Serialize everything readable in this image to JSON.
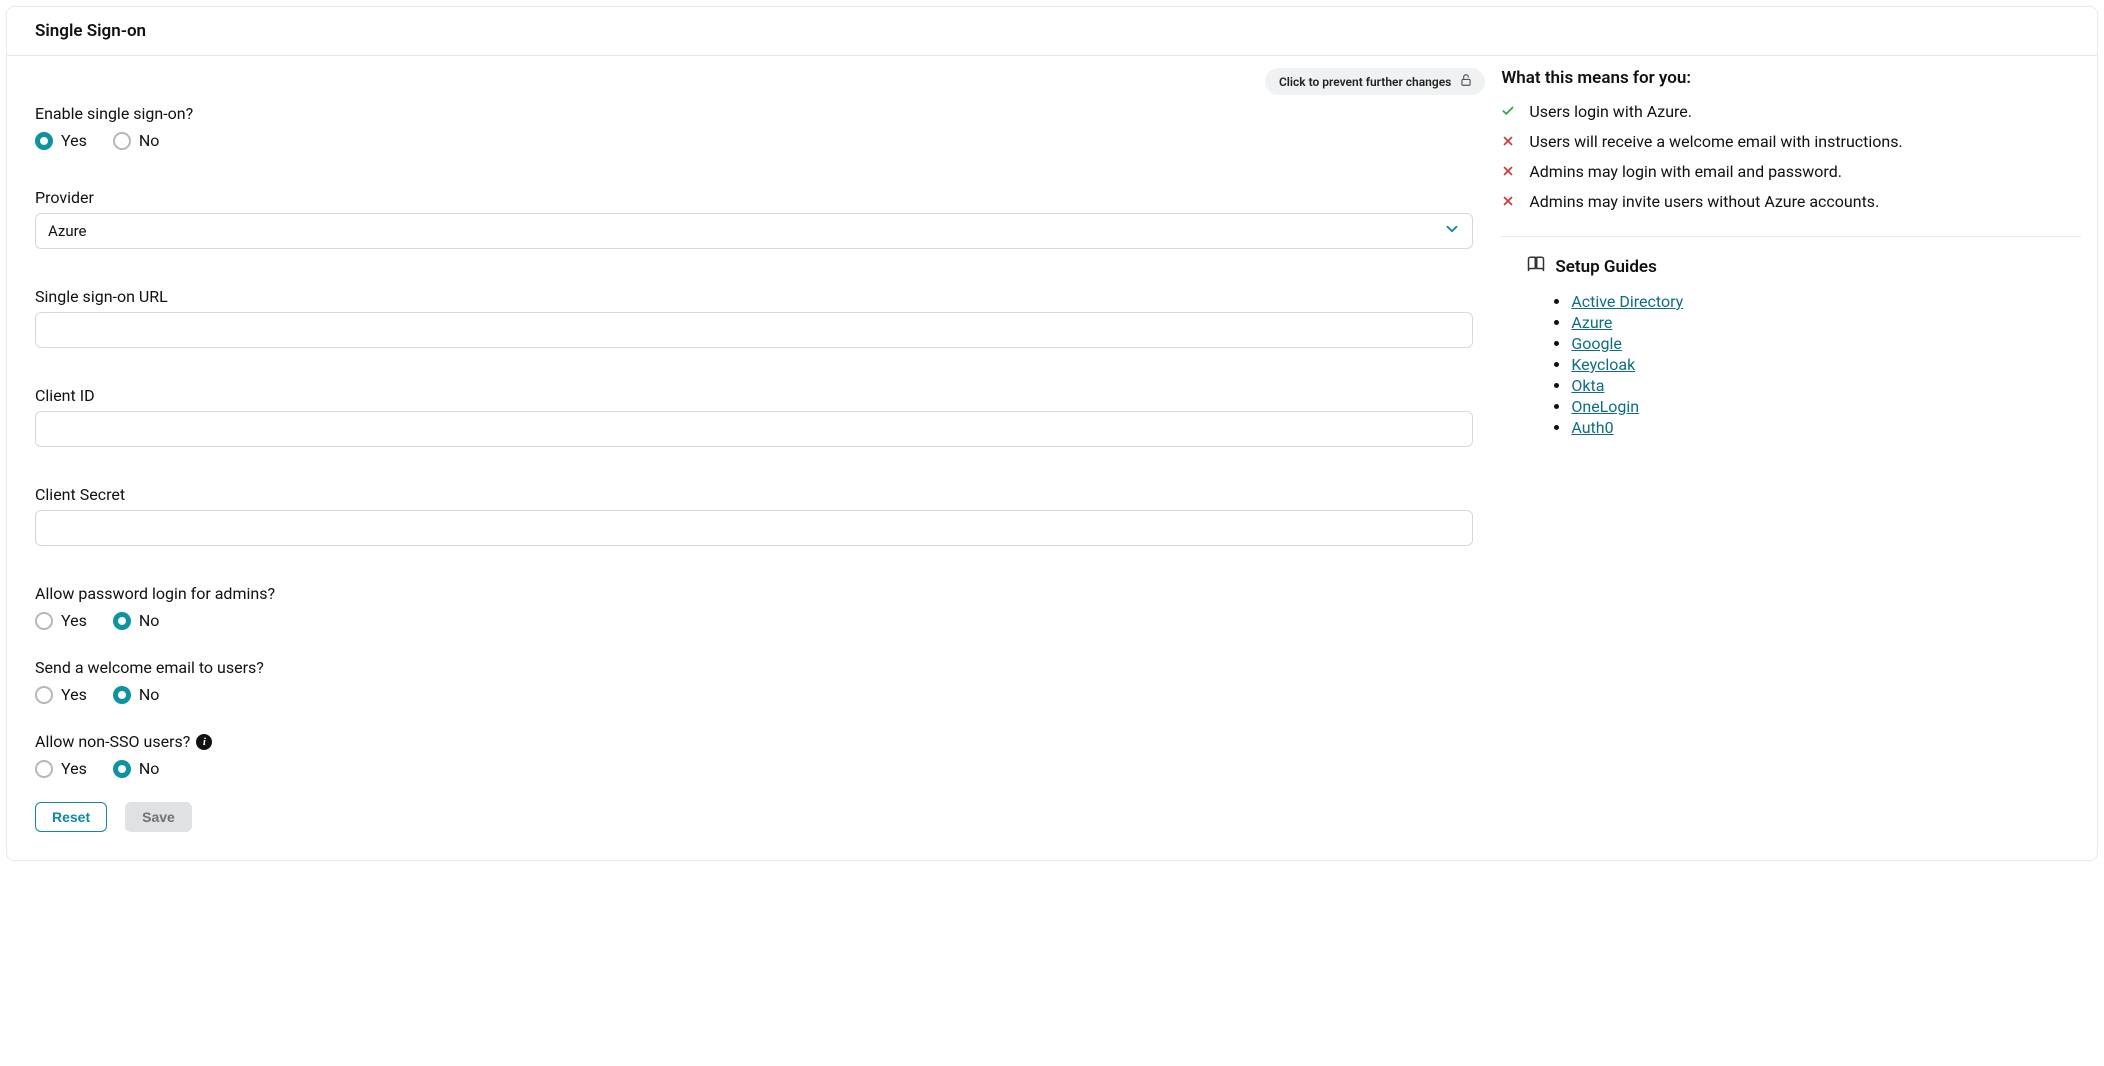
{
  "header": {
    "title": "Single Sign-on"
  },
  "lock": {
    "label": "Click to prevent further changes"
  },
  "fields": {
    "enable": {
      "label": "Enable single sign-on?",
      "yes": "Yes",
      "no": "No"
    },
    "provider": {
      "label": "Provider",
      "selected": "Azure"
    },
    "sso_url": {
      "label": "Single sign-on URL"
    },
    "client_id": {
      "label": "Client ID"
    },
    "client_secret": {
      "label": "Client Secret"
    },
    "allow_admin_pw": {
      "label": "Allow password login for admins?",
      "yes": "Yes",
      "no": "No"
    },
    "welcome_email": {
      "label": "Send a welcome email to users?",
      "yes": "Yes",
      "no": "No"
    },
    "allow_non_sso": {
      "label": "Allow non-SSO users?",
      "yes": "Yes",
      "no": "No"
    }
  },
  "buttons": {
    "reset": "Reset",
    "save": "Save"
  },
  "sidebar": {
    "heading": "What this means for you:",
    "items": {
      "0": "Users login with Azure.",
      "1": "Users will receive a welcome email with instructions.",
      "2": "Admins may login with email and password.",
      "3": "Admins may invite users without Azure accounts."
    },
    "guides_heading": "Setup Guides",
    "guides": {
      "0": "Active Directory",
      "1": "Azure",
      "2": "Google",
      "3": "Keycloak",
      "4": "Okta",
      "5": "OneLogin",
      "6": "Auth0"
    }
  }
}
